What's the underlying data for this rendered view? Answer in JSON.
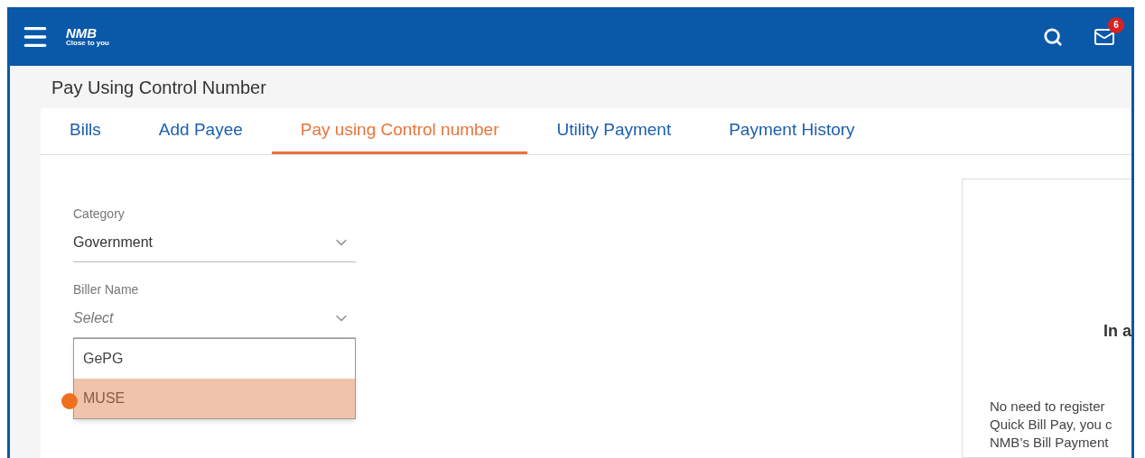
{
  "header": {
    "logo": "NMB",
    "tagline": "Close to you",
    "notifications": "6"
  },
  "page_title": "Pay Using Control Number",
  "tabs": [
    {
      "label": "Bills",
      "selected": false
    },
    {
      "label": "Add Payee",
      "selected": false
    },
    {
      "label": "Pay using Control number",
      "selected": true
    },
    {
      "label": "Utility Payment",
      "selected": false
    },
    {
      "label": "Payment History",
      "selected": false
    }
  ],
  "form": {
    "category": {
      "label": "Category",
      "value": "Government"
    },
    "biller": {
      "label": "Biller Name",
      "placeholder": "Select",
      "expanded": true,
      "options": [
        {
          "label": "GePG",
          "selected": false
        },
        {
          "label": "MUSE",
          "selected": true
        }
      ]
    }
  },
  "info_card": {
    "heading": "In a",
    "lines": [
      "No need to register",
      "Quick Bill Pay, you c",
      "NMB’s Bill Payment"
    ]
  }
}
